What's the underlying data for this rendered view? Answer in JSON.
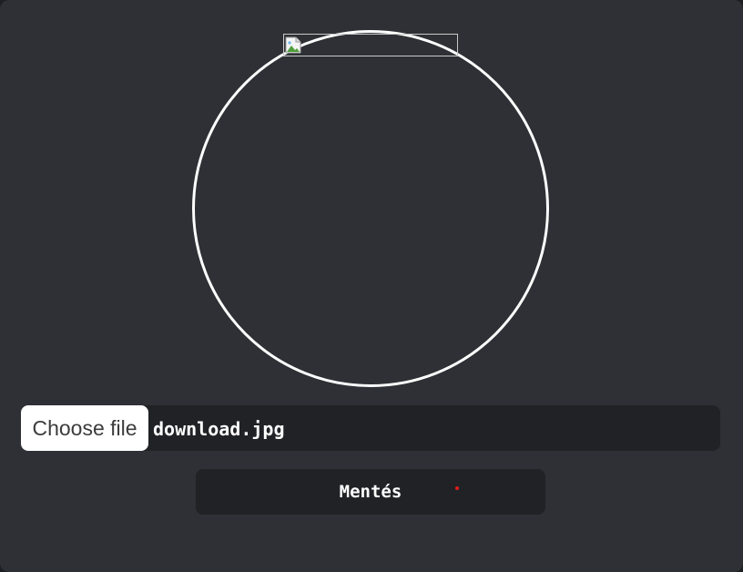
{
  "avatar": {
    "image_icon": "broken-image-icon"
  },
  "file_input": {
    "button_label": "Choose file",
    "selected_file": "download.jpg"
  },
  "save": {
    "label": "Mentés",
    "indicator_color": "#e01b1b"
  },
  "colors": {
    "panel_background": "#2f3035",
    "field_background": "#212226",
    "text": "#ffffff",
    "circle_stroke": "#ffffff"
  }
}
